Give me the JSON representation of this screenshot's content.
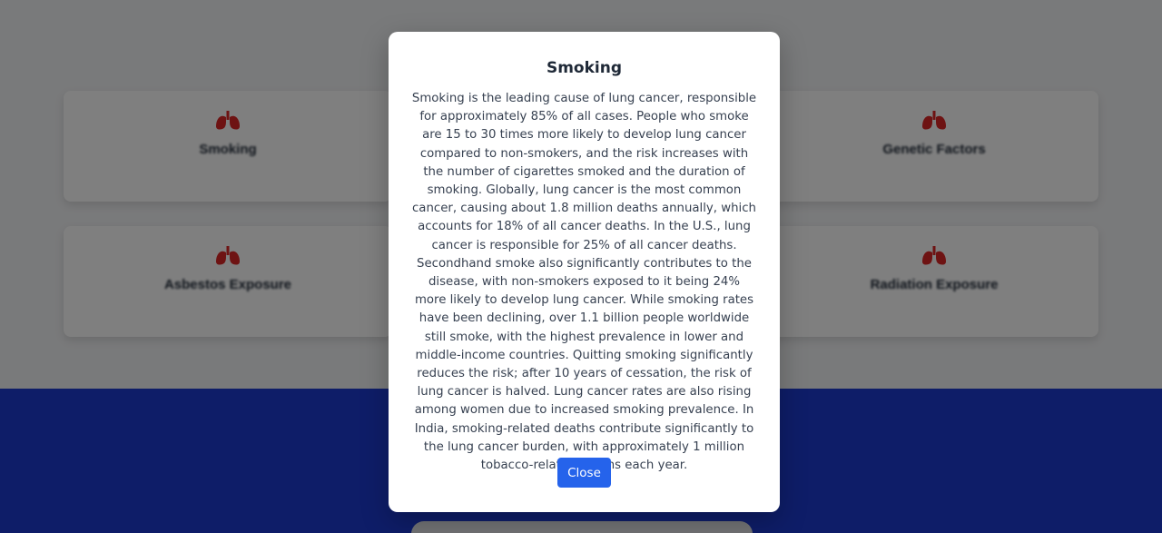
{
  "cards": [
    {
      "title": "Smoking",
      "icon": "lungs-icon"
    },
    {
      "title": "Genetic Factors",
      "icon": "lungs-icon"
    },
    {
      "title": "Asbestos Exposure",
      "icon": "lungs-icon"
    },
    {
      "title": "Radiation Exposure",
      "icon": "lungs-icon"
    }
  ],
  "modal": {
    "title": "Smoking",
    "body": "Smoking is the leading cause of lung cancer, responsible for approximately 85% of all cases. People who smoke are 15 to 30 times more likely to develop lung cancer compared to non-smokers, and the risk increases with the number of cigarettes smoked and the duration of smoking. Globally, lung cancer is the most common cancer, causing about 1.8 million deaths annually, which accounts for 18% of all cancer deaths. In the U.S., lung cancer is responsible for 25% of all cancer deaths. Secondhand smoke also significantly contributes to the disease, with non-smokers exposed to it being 24% more likely to develop lung cancer. While smoking rates have been declining, over 1.1 billion people worldwide still smoke, with the highest prevalence in lower and middle-income countries. Quitting smoking significantly reduces the risk; after 10 years of cessation, the risk of lung cancer is halved. Lung cancer rates are also rising among women due to increased smoking prevalence. In India, smoking-related deaths contribute significantly to the lung cancer burden, with approximately 1 million tobacco-related deaths each year.",
    "close_label": "Close"
  },
  "colors": {
    "accent": "#2563eb",
    "icon": "#dc2626",
    "footer_bg": "#1d3ad0"
  }
}
